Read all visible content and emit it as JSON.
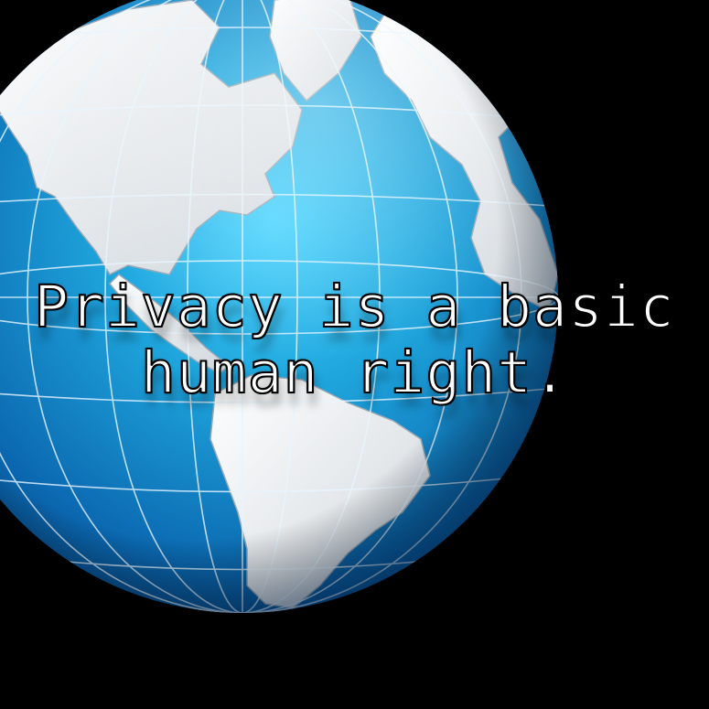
{
  "scene": {
    "background_color": "#000000",
    "ocean_color": "#1fa6dd",
    "ocean_dark_color": "#063f7a",
    "land_color": "#f2f4f6",
    "gridline_color": "#e8f6ff"
  },
  "quote": {
    "line1": "Privacy is a basic",
    "line2": "human right."
  },
  "icons": {
    "globe": "globe-icon"
  }
}
